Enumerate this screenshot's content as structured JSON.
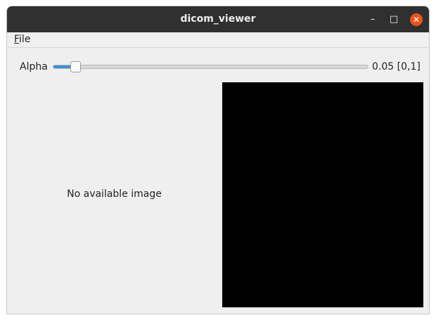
{
  "window": {
    "title": "dicom_viewer",
    "minimize": "–",
    "maximize": "□",
    "close": "✕"
  },
  "menubar": {
    "items": [
      {
        "label": "File",
        "mnemonic": "F",
        "rest": "ile"
      }
    ]
  },
  "slider": {
    "label": "Alpha",
    "value": 0.05,
    "value_text": "0.05 [0,1]",
    "min": 0,
    "max": 1,
    "accent": "#3d8fd6"
  },
  "left_panel": {
    "message": "No available image"
  },
  "right_panel": {
    "background": "#000000"
  }
}
